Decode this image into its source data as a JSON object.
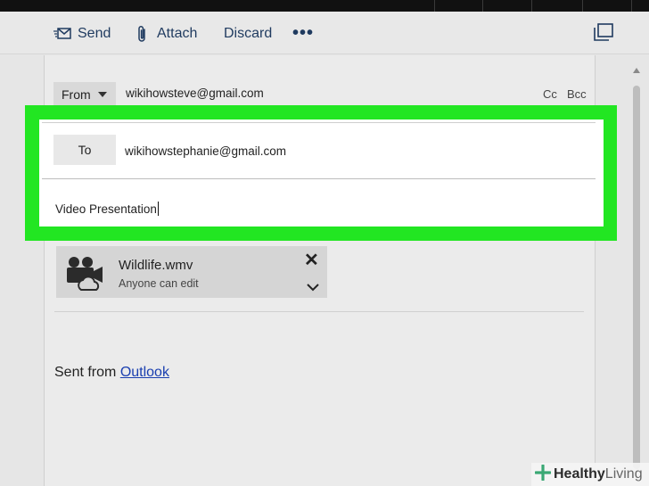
{
  "toolbar": {
    "send_label": "Send",
    "attach_label": "Attach",
    "discard_label": "Discard",
    "more_label": "•••"
  },
  "compose": {
    "from_label": "From",
    "from_address": "wikihowsteve@gmail.com",
    "cc_label": "Cc",
    "bcc_label": "Bcc",
    "to_label": "To",
    "to_address": "wikihowstephanie@gmail.com",
    "subject": "Video Presentation"
  },
  "attachment": {
    "name": "Wildlife.wmv",
    "permission": "Anyone can edit",
    "remove_symbol": "✕"
  },
  "body": {
    "signature_prefix": "Sent from",
    "signature_link": "Outlook"
  },
  "watermark": {
    "brand": "Healthy",
    "brand_suffix": "Living"
  },
  "colors": {
    "highlight": "#22e622",
    "toolbar_text": "#1f3a5f",
    "link": "#1a3fb0"
  }
}
